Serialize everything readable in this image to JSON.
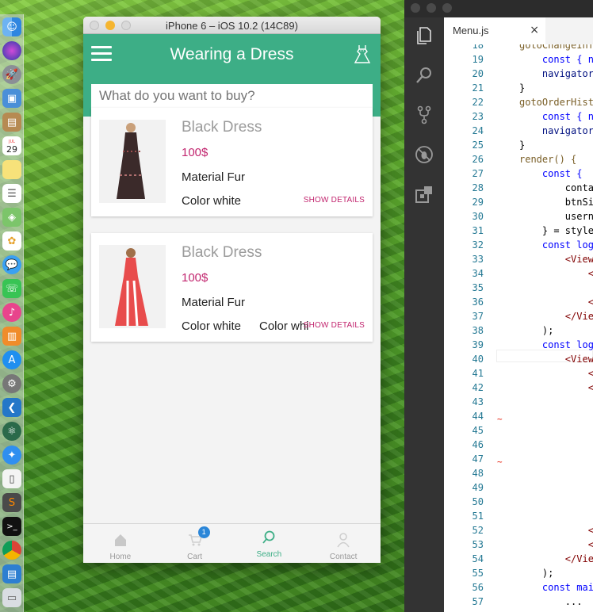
{
  "simulator": {
    "title": "iPhone 6 – iOS 10.2 (14C89)"
  },
  "app": {
    "title": "Wearing a Dress",
    "search_placeholder": "What do you want to buy?",
    "accent_color": "#3dae86",
    "price_color": "#c2266f",
    "products": [
      {
        "name": "Black Dress",
        "price": "100$",
        "material": "Material Fur",
        "color": "Color white",
        "color2": "",
        "details_label": "SHOW DETAILS"
      },
      {
        "name": "Black Dress",
        "price": "100$",
        "material": "Material Fur",
        "color": "Color white",
        "color2": "Color white",
        "details_label": "SHOW DETAILS"
      }
    ],
    "tabs": [
      {
        "label": "Home",
        "icon": "home-icon"
      },
      {
        "label": "Cart",
        "icon": "cart-icon",
        "badge": "1"
      },
      {
        "label": "Search",
        "icon": "search-icon",
        "active": true
      },
      {
        "label": "Contact",
        "icon": "person-icon"
      }
    ]
  },
  "editor": {
    "file_tab": "Menu.js",
    "close_glyph": "×",
    "line_numbers": [
      "18",
      "19",
      "20",
      "21",
      "22",
      "23",
      "24",
      "25",
      "26",
      "27",
      "28",
      "29",
      "30",
      "31",
      "32",
      "33",
      "34",
      "35",
      "36",
      "37",
      "38",
      "39",
      "40",
      "41",
      "42",
      "43",
      "44",
      "45",
      "46",
      "47",
      "48",
      "49",
      "50",
      "51",
      "52",
      "53",
      "54",
      "55",
      "56",
      "57"
    ],
    "code_lines": [
      "gotoChangeInf",
      "    const { n",
      "    navigator",
      "}",
      "gotoOrderHist",
      "    const { n",
      "    navigator",
      "}",
      "render() {",
      "    const {",
      "        conta",
      "        btnSi",
      "        usern",
      "    } = style",
      "    const log",
      "        <View",
      "            <",
      "",
      "            <",
      "        </Vie",
      "    );",
      "    const log",
      "        <View",
      "            <",
      "            <",
      "",
      "",
      "",
      "",
      "",
      "",
      "",
      "",
      "",
      "            <",
      "            <",
      "        </Vie",
      "    );",
      "    const mai",
      "        ..."
    ]
  },
  "dock": {
    "calendar_day": "29",
    "calendar_month": "JUL"
  }
}
